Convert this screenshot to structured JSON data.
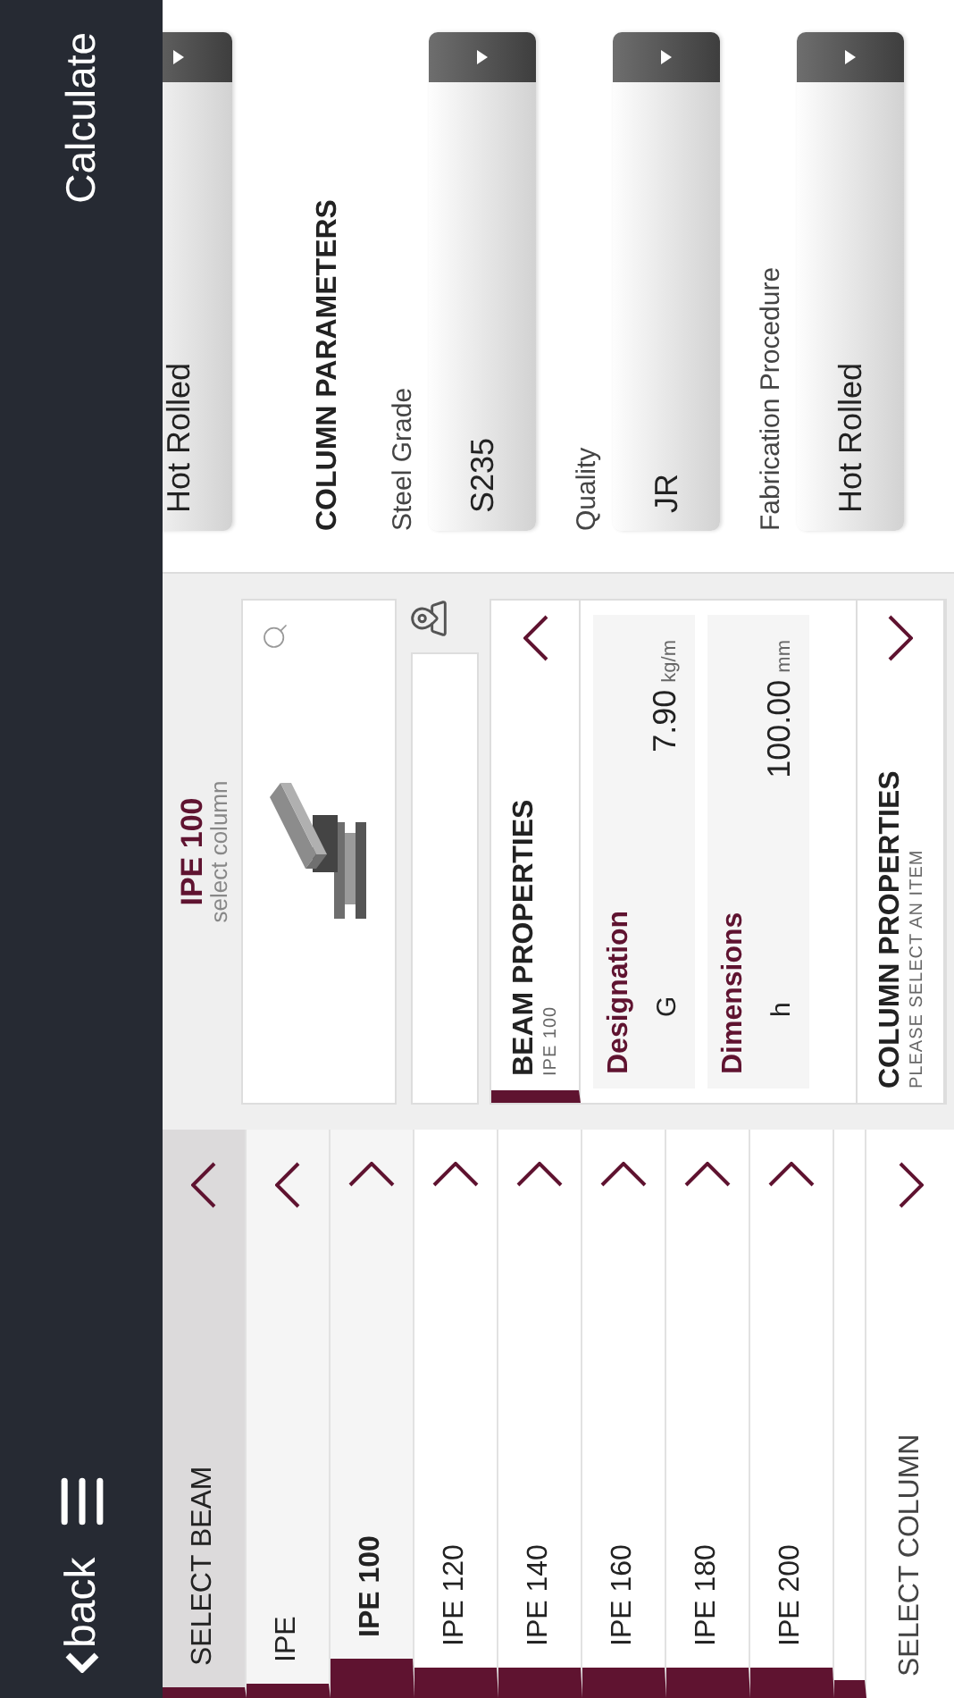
{
  "nav": {
    "back": "back",
    "action": "Calculate"
  },
  "beam_list": [
    {
      "label": "SELECT BEAM",
      "kind": "section",
      "selected": false
    },
    {
      "label": "IPE",
      "kind": "category",
      "selected": false
    },
    {
      "label": "IPE 100",
      "kind": "item",
      "selected": true
    },
    {
      "label": "IPE 120",
      "kind": "item",
      "selected": false
    },
    {
      "label": "IPE 140",
      "kind": "item",
      "selected": false
    },
    {
      "label": "IPE 160",
      "kind": "item",
      "selected": false
    },
    {
      "label": "IPE 180",
      "kind": "item",
      "selected": false
    },
    {
      "label": "IPE 200",
      "kind": "item",
      "selected": false
    }
  ],
  "column_select": {
    "label": "SELECT COLUMN"
  },
  "selection": {
    "title": "IPE 100",
    "subtitle": "select column"
  },
  "beam_properties": {
    "title": "BEAM PROPERTIES",
    "subtitle": "IPE 100",
    "expanded": true,
    "groups": [
      {
        "title": "Designation",
        "rows": [
          {
            "name": "G",
            "value": "7.90",
            "unit": "kg/m"
          }
        ]
      },
      {
        "title": "Dimensions",
        "rows": [
          {
            "name": "h",
            "value": "100.00",
            "unit": "mm"
          }
        ]
      }
    ]
  },
  "column_properties": {
    "title": "COLUMN PROPERTIES",
    "subtitle": "PLEASE SELECT AN ITEM",
    "expanded": false
  },
  "parameters": {
    "previous_value": "Hot Rolled",
    "title": "COLUMN PARAMETERS",
    "fields": [
      {
        "label": "Steel Grade",
        "value": "S235"
      },
      {
        "label": "Quality",
        "value": "JR"
      },
      {
        "label": "Fabrication Procedure",
        "value": "Hot Rolled"
      }
    ]
  }
}
